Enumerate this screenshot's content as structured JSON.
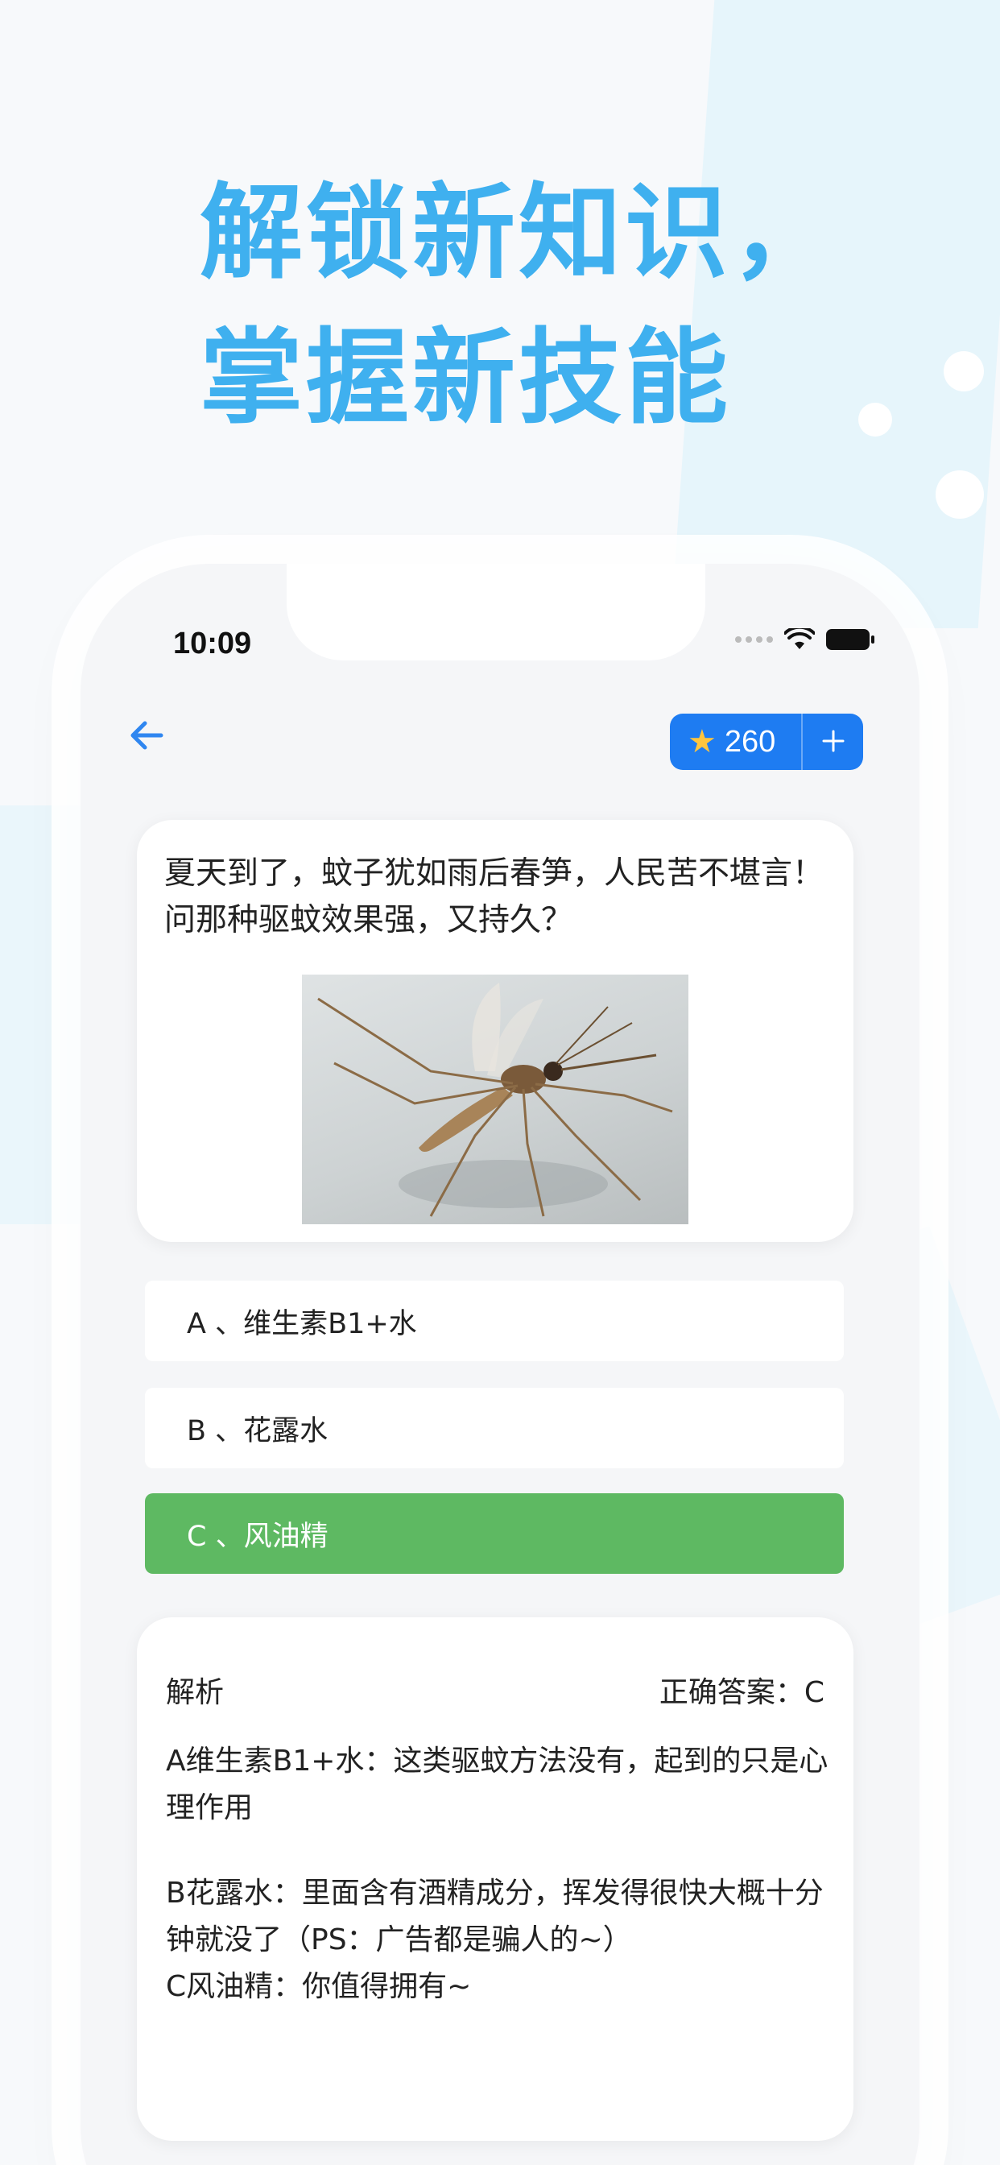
{
  "headline": {
    "line1": "解锁新知识，",
    "line2": "掌握新技能"
  },
  "status_bar": {
    "time": "10:09"
  },
  "header": {
    "coin_count": "260"
  },
  "question": {
    "text": "夏天到了，蚊子犹如雨后春笋，人民苦不堪言！问那种驱蚊效果强，又持久？"
  },
  "options": [
    {
      "label": "A 、维生素B1+水",
      "state": "normal"
    },
    {
      "label": "B 、花露水",
      "state": "normal"
    },
    {
      "label": "C 、风油精",
      "state": "correct"
    }
  ],
  "analysis": {
    "title": "解析",
    "answer": "正确答案：C",
    "paragraphs": [
      "A维生素B1+水：这类驱蚊方法没有，起到的只是心理作用",
      "B花露水：里面含有酒精成分，挥发得很快大概十分钟就没了（PS：广告都是骗人的~）",
      "C风油精：你值得拥有~"
    ]
  },
  "colors": {
    "headline": "#3fb0ef",
    "accent_blue": "#1e7cf2",
    "correct_green": "#5eb962"
  },
  "icons": [
    "back-arrow-icon",
    "star-icon",
    "plus-icon",
    "wifi-icon",
    "battery-icon",
    "signal-icon"
  ]
}
